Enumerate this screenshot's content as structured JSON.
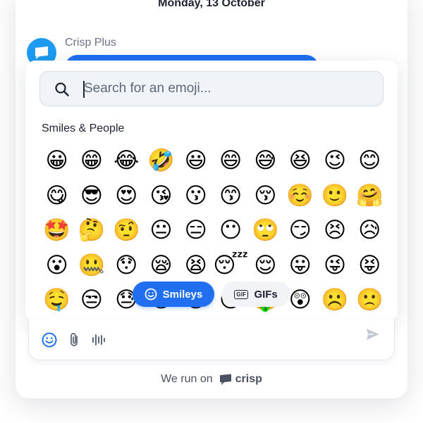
{
  "conversation": {
    "date_header": "Monday, 13 October",
    "sender_name": "Crisp Plus"
  },
  "emoji_picker": {
    "search": {
      "placeholder": "Search for an emoji...",
      "value": ""
    },
    "category_title": "Smiles & People",
    "emojis": [
      "😀",
      "😁",
      "😂",
      "🤣",
      "😃",
      "😄",
      "😅",
      "😆",
      "😉",
      "😊",
      "😋",
      "😎",
      "😍",
      "😘",
      "😗",
      "😙",
      "😚",
      "☺️",
      "🙂",
      "🤗",
      "🤩",
      "🤔",
      "🤨",
      "😐",
      "😑",
      "😶",
      "🙄",
      "😏",
      "😣",
      "😥",
      "😮",
      "🤐",
      "😯",
      "😪",
      "😫",
      "😴",
      "😌",
      "😛",
      "😜",
      "😝",
      "🤤",
      "😒",
      "😓",
      "😔",
      "😕",
      "🙃",
      "🤑",
      "😲",
      "☹️",
      "🙁"
    ],
    "tabs": {
      "smileys": "Smileys",
      "gifs": "GIFs",
      "gif_badge": "GIF"
    }
  },
  "composer": {
    "emoji_icon": "smiley-icon",
    "attach_icon": "paperclip-icon",
    "audio_icon": "waveform-icon",
    "send_icon": "send-icon"
  },
  "footer": {
    "prefix": "We run on",
    "brand_name": "crisp"
  },
  "colors": {
    "accent": "#1f6ff0",
    "avatar": "#1d9bf0",
    "text": "#1c2230",
    "muted": "#6b7485"
  }
}
